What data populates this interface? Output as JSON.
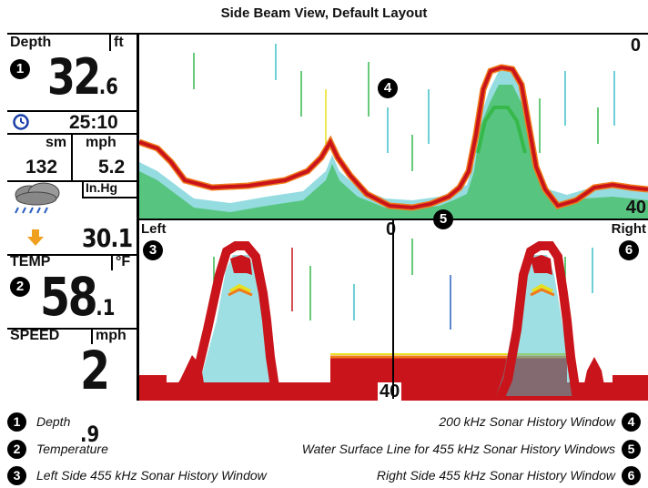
{
  "page": {
    "title": "Side Beam View, Default Layout"
  },
  "panel": {
    "depth": {
      "label": "Depth",
      "unit": "ft",
      "int": "32",
      "dec": ".6"
    },
    "timer": {
      "icon": "clock-icon",
      "value": "25:10"
    },
    "distance": {
      "unit": "sm",
      "value": "132"
    },
    "speed_small": {
      "unit": "mph",
      "value": "5.2"
    },
    "pressure": {
      "icon": "cloud-rain-icon",
      "unit": "In.Hg",
      "trend_icon": "arrow-down-icon",
      "value": "30.1"
    },
    "temperature": {
      "label": "TEMP",
      "unit": "°F",
      "int": "58",
      "dec": ".1"
    },
    "speed": {
      "label": "SPEED",
      "unit": "mph",
      "int": "2",
      "dec": ".9"
    }
  },
  "sonar": {
    "top": {
      "scale_top": "0",
      "scale_bottom": "40"
    },
    "bottom": {
      "left_label": "Left",
      "right_label": "Right",
      "scale_top": "0",
      "scale_bottom": "40"
    }
  },
  "callouts": [
    "1",
    "2",
    "3",
    "4",
    "5",
    "6"
  ],
  "legend": {
    "left": [
      {
        "badge": "1",
        "text": "Depth"
      },
      {
        "badge": "2",
        "text": "Temperature"
      },
      {
        "badge": "3",
        "text": "Left Side 455 kHz Sonar History Window"
      }
    ],
    "right": [
      {
        "badge": "4",
        "text": "200 kHz Sonar History Window"
      },
      {
        "badge": "5",
        "text": "Water Surface Line for 455 kHz Sonar History Windows"
      },
      {
        "badge": "6",
        "text": "Right Side 455 kHz Sonar History Window"
      }
    ]
  },
  "colors": {
    "bottom_red": "#c8141a",
    "orange": "#f07a1a",
    "yellow": "#e6e01e",
    "green": "#36b84a",
    "cyan": "#3ec0c8",
    "blue": "#2a5fbf"
  }
}
